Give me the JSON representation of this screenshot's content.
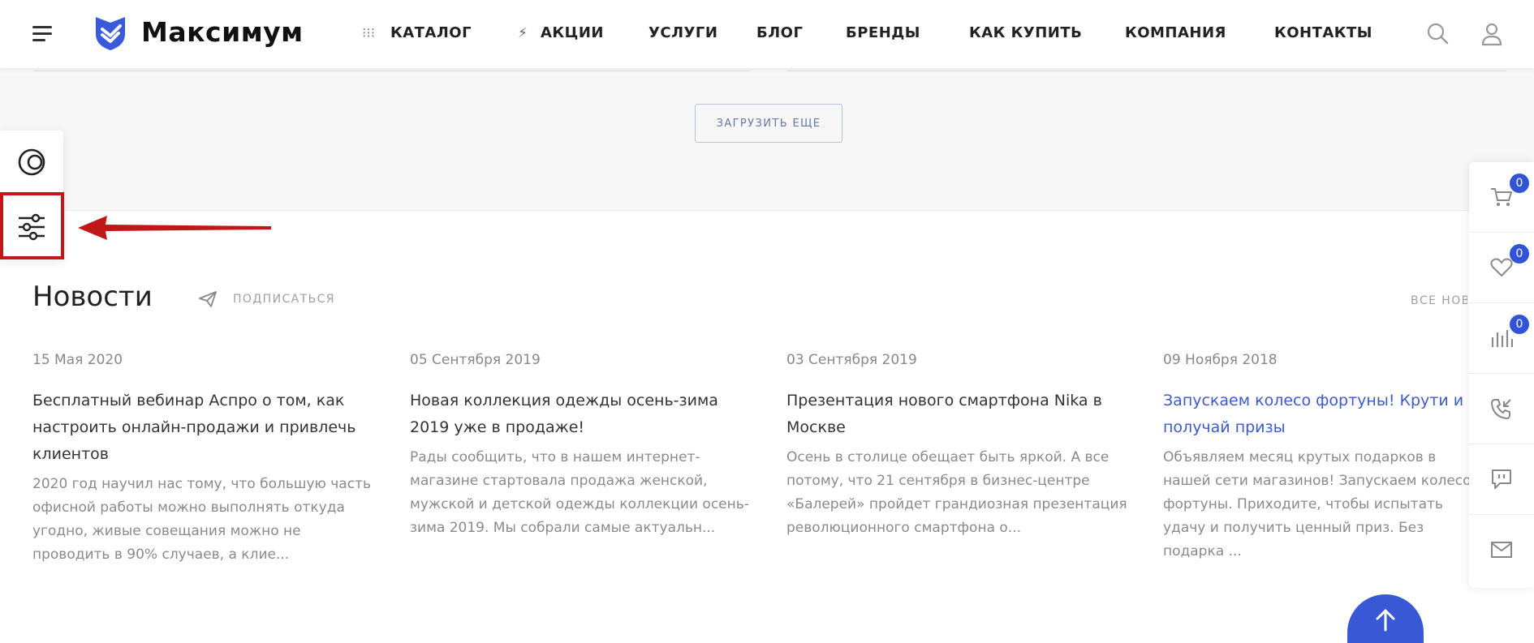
{
  "header": {
    "logo_text": "Максимум",
    "nav": [
      {
        "label": "КАТАЛОГ",
        "icon": "grid-dots-icon"
      },
      {
        "label": "АКЦИИ",
        "icon": "lightning-icon"
      },
      {
        "label": "УСЛУГИ"
      },
      {
        "label": "БЛОГ"
      },
      {
        "label": "БРЕНДЫ"
      },
      {
        "label": "КАК КУПИТЬ"
      },
      {
        "label": "КОМПАНИЯ"
      },
      {
        "label": "КОНТАКТЫ"
      }
    ]
  },
  "load_more_label": "ЗАГРУЗИТЬ ЕЩЕ",
  "news": {
    "title": "Новости",
    "subscribe_label": "ПОДПИСАТЬСЯ",
    "all_label": "ВСЕ НОВОСТИ",
    "items": [
      {
        "date": "15 Мая 2020",
        "title": "Бесплатный вебинар Аспро о том, как настроить онлайн-продажи и привлечь клиентов",
        "text": "2020 год научил нас тому, что большую часть офисной работы можно выполнять откуда угодно, живые совещания можно не проводить в 90% случаев, а клие..."
      },
      {
        "date": "05 Сентября 2019",
        "title": "Новая коллекция одежды осень-зима 2019 уже в продаже!",
        "text": "Рады сообщить, что в нашем интернет-магазине стартовала продажа женской, мужской и детской одежды коллекции осень-зима 2019. Мы собрали самые актуальн..."
      },
      {
        "date": "03 Сентября 2019",
        "title": "Презентация нового смартфона Nika в Москве",
        "text": "Осень в столице обещает быть яркой. А все потому, что 21 сентября в бизнес-центре «Балерей» пройдет грандиозная презентация революционного смартфона о..."
      },
      {
        "date": "09 Ноября 2018",
        "title": "Запускаем колесо фортуны! Крути и получай призы",
        "text": "Объявляем месяц крутых подарков в нашей сети магазинов! Запускаем колесо фортуны. Приходите, чтобы испытать удачу и получить ценный приз. Без подарка ..."
      }
    ]
  },
  "right_panel": {
    "cart_count": "0",
    "favorites_count": "0",
    "compare_count": "0"
  },
  "colors": {
    "accent": "#3153d6",
    "highlight": "#c01818",
    "link": "#3b5bc7"
  }
}
